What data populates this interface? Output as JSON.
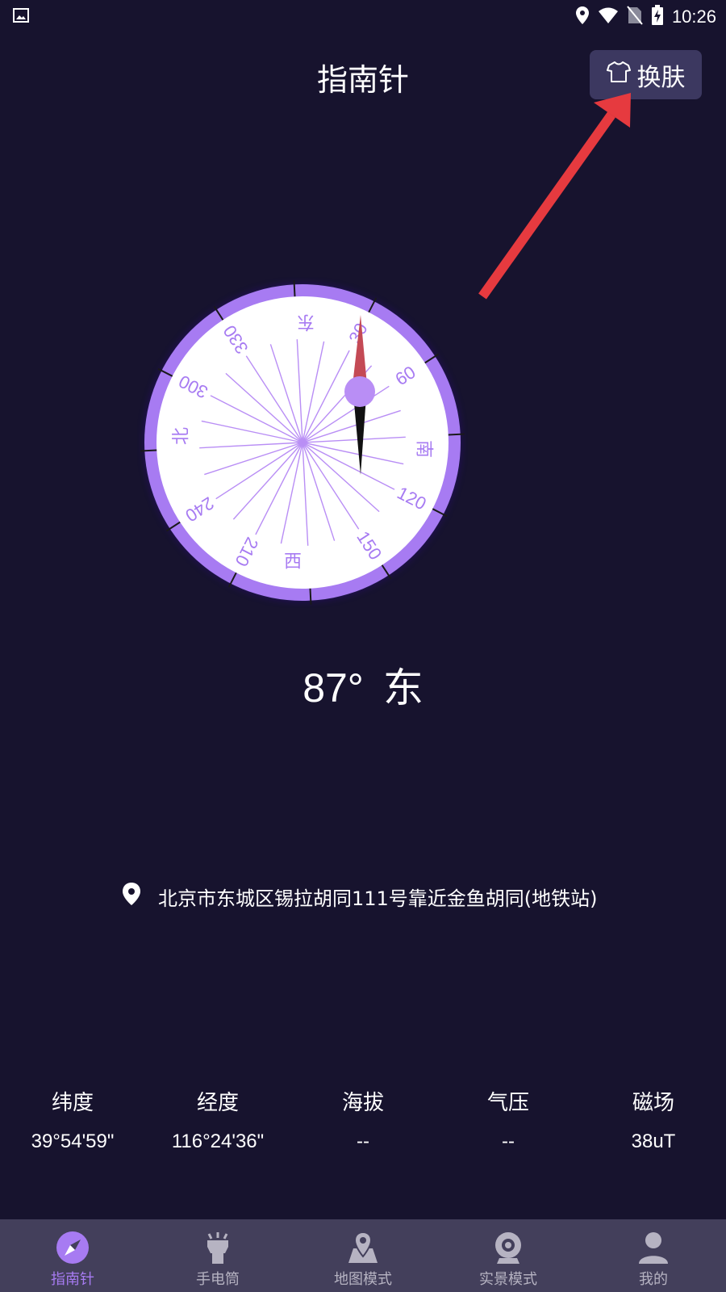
{
  "status_bar": {
    "time": "10:26",
    "left_icon": "gallery-icon",
    "right_icons": [
      "location-icon",
      "wifi-icon",
      "no-sim-icon",
      "battery-charging-icon"
    ]
  },
  "header": {
    "title": "指南针",
    "skin_button": {
      "label": "换肤",
      "icon": "tshirt-icon"
    }
  },
  "compass": {
    "cardinals": {
      "north": "北",
      "east": "东",
      "south": "南",
      "west": "西"
    },
    "degree_labels": [
      "30",
      "60",
      "120",
      "150",
      "210",
      "240",
      "300",
      "330"
    ],
    "colors": {
      "ring": "#a77bf2",
      "needle_north": "#c44a55",
      "needle_south": "#111111",
      "label": "#a77bf2"
    }
  },
  "reading": {
    "degrees": "87°",
    "direction": "东"
  },
  "location": {
    "address": "北京市东城区锡拉胡同111号靠近金鱼胡同(地铁站)"
  },
  "stats": [
    {
      "label": "纬度",
      "value": "39°54'59\""
    },
    {
      "label": "经度",
      "value": "116°24'36\""
    },
    {
      "label": "海拔",
      "value": "--"
    },
    {
      "label": "气压",
      "value": "--"
    },
    {
      "label": "磁场",
      "value": "38uT"
    }
  ],
  "nav": [
    {
      "label": "指南针",
      "icon": "compass-icon",
      "active": true
    },
    {
      "label": "手电筒",
      "icon": "flashlight-icon",
      "active": false
    },
    {
      "label": "地图模式",
      "icon": "map-icon",
      "active": false
    },
    {
      "label": "实景模式",
      "icon": "camera-icon",
      "active": false
    },
    {
      "label": "我的",
      "icon": "person-icon",
      "active": false
    }
  ],
  "accent_color": "#a77bf2",
  "annotation_arrow_color": "#e63a3f"
}
